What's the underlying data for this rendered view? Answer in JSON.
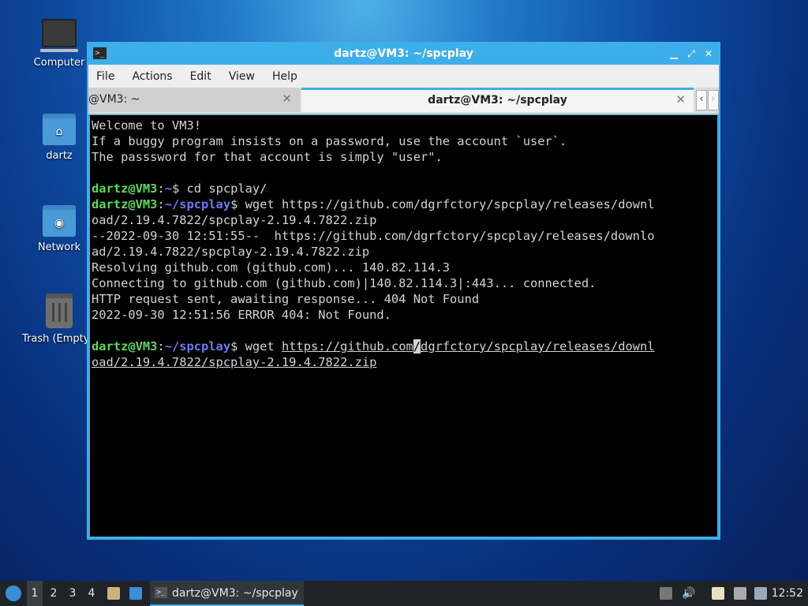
{
  "desktop": {
    "icons": [
      {
        "label": "Computer"
      },
      {
        "label": "dartz"
      },
      {
        "label": "Network"
      },
      {
        "label": "Trash (Empty)"
      }
    ]
  },
  "window": {
    "title": "dartz@VM3: ~/spcplay",
    "menu": [
      "File",
      "Actions",
      "Edit",
      "View",
      "Help"
    ],
    "tabs": [
      {
        "label": "@VM3: ~",
        "active": false
      },
      {
        "label": "dartz@VM3: ~/spcplay",
        "active": true
      }
    ],
    "terminal": {
      "lines": [
        "Welcome to VM3!",
        "If a buggy program insists on a password, use the account `user`.",
        "The passsword for that account is simply \"user\".",
        "",
        "--2022-09-30 12:51:55--  https://github.com/dgrfctory/spcplay/releases/downlo",
        "ad/2.19.4.7822/spcplay-2.19.4.7822.zip",
        "Resolving github.com (github.com)... 140.82.114.3",
        "Connecting to github.com (github.com)|140.82.114.3|:443... connected.",
        "HTTP request sent, awaiting response... 404 Not Found",
        "2022-09-30 12:51:56 ERROR 404: Not Found."
      ],
      "prompt_user": "dartz@VM3",
      "prompt_home": "~",
      "prompt_dir": "~/spcplay",
      "cmd1": "cd spcplay/",
      "cmd2_a": "wget https://github.com/dgrfctory/spcplay/releases/downl",
      "cmd2_b": "oad/2.19.4.7822/spcplay-2.19.4.7822.zip",
      "cmd3_a": "https://github.com",
      "cmd3_cursor": "/",
      "cmd3_b": "dgrfctory/spcplay/releases/downl",
      "cmd3_c": "oad/2.19.4.7822/spcplay-2.19.4.7822.zip"
    }
  },
  "taskbar": {
    "workspaces": [
      "1",
      "2",
      "3",
      "4"
    ],
    "active_window": "dartz@VM3: ~/spcplay",
    "clock": "12:52"
  },
  "colors": {
    "accent": "#3daee9",
    "prompt_user": "#5fd75f",
    "prompt_path": "#6b7cf0"
  }
}
